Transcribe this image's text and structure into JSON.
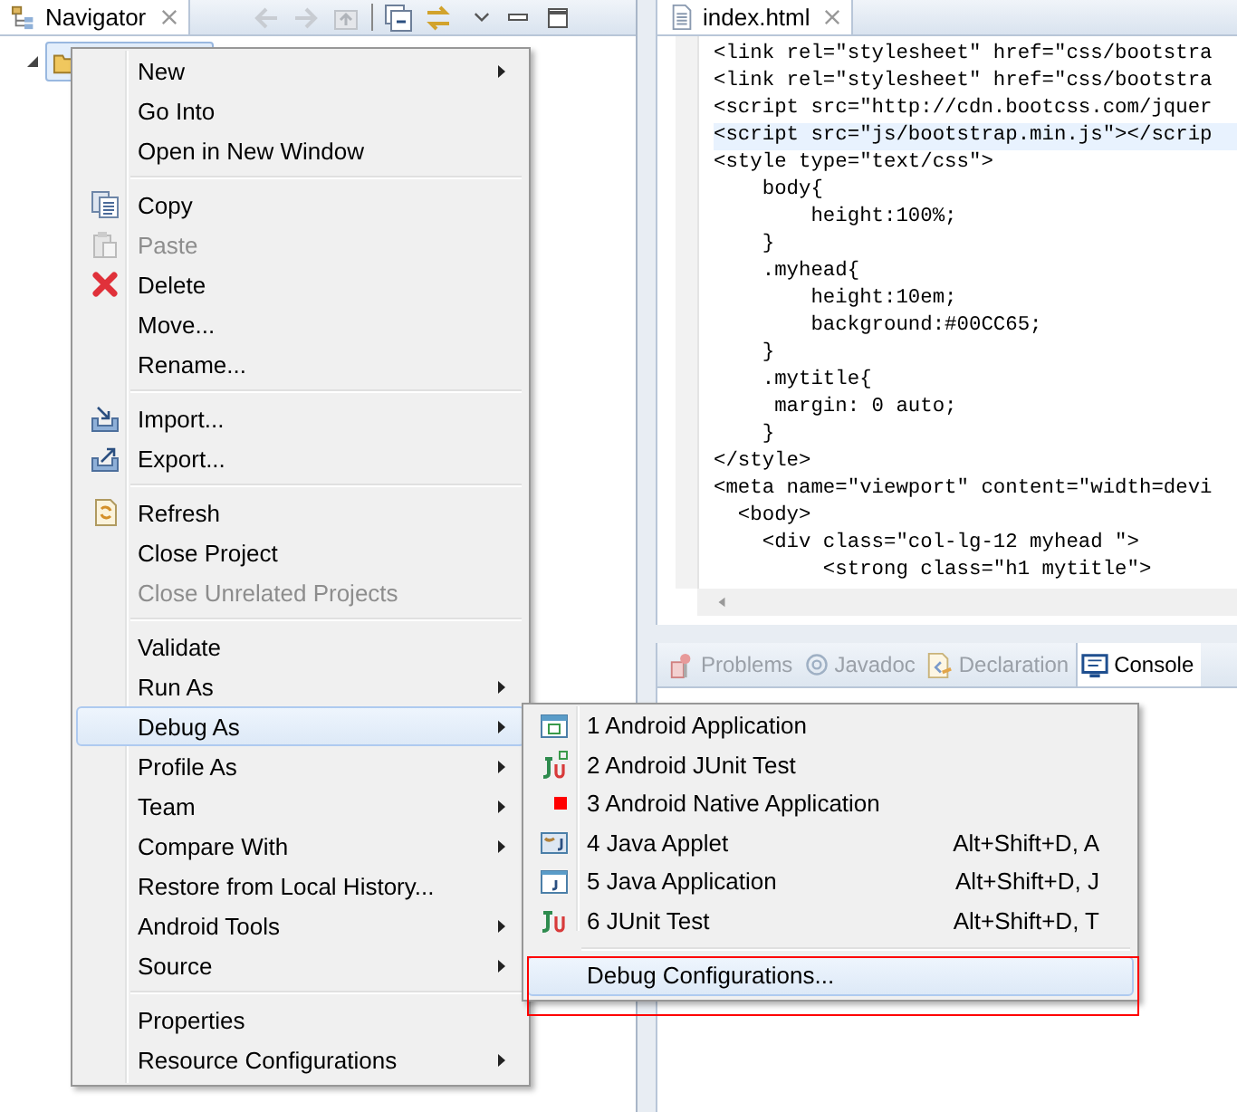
{
  "navigator": {
    "tab": {
      "label": "Navigator",
      "selected": true
    },
    "tree_root": {
      "expanded": true,
      "selected": true
    }
  },
  "editor": {
    "tab": {
      "label": "index.html",
      "selected": true
    },
    "lines": [
      {
        "text": "<link rel=\"stylesheet\" href=\"css/bootstra",
        "current": false
      },
      {
        "text": "<link rel=\"stylesheet\" href=\"css/bootstra",
        "current": false
      },
      {
        "text": "<script src=\"http://cdn.bootcss.com/jquer",
        "current": false
      },
      {
        "text": "<script src=\"js/bootstrap.min.js\"></scrip",
        "current": true
      },
      {
        "text": "<style type=\"text/css\">",
        "current": false
      },
      {
        "text": "    body{",
        "current": false
      },
      {
        "text": "        height:100%;",
        "current": false
      },
      {
        "text": "    }",
        "current": false
      },
      {
        "text": "    .myhead{",
        "current": false
      },
      {
        "text": "        height:10em;",
        "current": false
      },
      {
        "text": "        background:#00CC65;",
        "current": false
      },
      {
        "text": "    }",
        "current": false
      },
      {
        "text": "    .mytitle{",
        "current": false
      },
      {
        "text": "     margin: 0 auto;",
        "current": false
      },
      {
        "text": "    }",
        "current": false
      },
      {
        "text": "</style>",
        "current": false
      },
      {
        "text": "<meta name=\"viewport\" content=\"width=devi",
        "current": false
      },
      {
        "text": "  <body>",
        "current": false
      },
      {
        "text": "    <div class=\"col-lg-12 myhead \">",
        "current": false
      },
      {
        "text": "         <strong class=\"h1 mytitle\">",
        "current": false
      }
    ]
  },
  "bottom_tabs": [
    {
      "label": "Problems",
      "kind": "problems",
      "selected": false
    },
    {
      "label": "Javadoc",
      "kind": "javadoc",
      "selected": false
    },
    {
      "label": "Declaration",
      "kind": "declaration",
      "selected": false
    },
    {
      "label": "Console",
      "kind": "console",
      "selected": true
    }
  ],
  "context_menu": {
    "groups": [
      [
        {
          "label": "New",
          "kind": "plain",
          "submenu": true,
          "disabled": false,
          "selected": false
        },
        {
          "label": "Go Into",
          "kind": "plain",
          "submenu": false,
          "disabled": false,
          "selected": false
        },
        {
          "label": "Open in New Window",
          "kind": "plain",
          "submenu": false,
          "disabled": false,
          "selected": false
        }
      ],
      [
        {
          "label": "Copy",
          "kind": "copy",
          "submenu": false,
          "disabled": false,
          "selected": false
        },
        {
          "label": "Paste",
          "kind": "paste",
          "submenu": false,
          "disabled": true,
          "selected": false
        },
        {
          "label": "Delete",
          "kind": "delete",
          "submenu": false,
          "disabled": false,
          "selected": false
        },
        {
          "label": "Move...",
          "kind": "plain",
          "submenu": false,
          "disabled": false,
          "selected": false
        },
        {
          "label": "Rename...",
          "kind": "plain",
          "submenu": false,
          "disabled": false,
          "selected": false
        }
      ],
      [
        {
          "label": "Import...",
          "kind": "import",
          "submenu": false,
          "disabled": false,
          "selected": false
        },
        {
          "label": "Export...",
          "kind": "export",
          "submenu": false,
          "disabled": false,
          "selected": false
        }
      ],
      [
        {
          "label": "Refresh",
          "kind": "refresh",
          "submenu": false,
          "disabled": false,
          "selected": false
        },
        {
          "label": "Close Project",
          "kind": "plain",
          "submenu": false,
          "disabled": false,
          "selected": false
        },
        {
          "label": "Close Unrelated Projects",
          "kind": "plain",
          "submenu": false,
          "disabled": true,
          "selected": false
        }
      ],
      [
        {
          "label": "Validate",
          "kind": "plain",
          "submenu": false,
          "disabled": false,
          "selected": false
        },
        {
          "label": "Run As",
          "kind": "plain",
          "submenu": true,
          "disabled": false,
          "selected": false
        },
        {
          "label": "Debug As",
          "kind": "plain",
          "submenu": true,
          "disabled": false,
          "selected": true
        },
        {
          "label": "Profile As",
          "kind": "plain",
          "submenu": true,
          "disabled": false,
          "selected": false
        },
        {
          "label": "Team",
          "kind": "plain",
          "submenu": true,
          "disabled": false,
          "selected": false
        },
        {
          "label": "Compare With",
          "kind": "plain",
          "submenu": true,
          "disabled": false,
          "selected": false
        },
        {
          "label": "Restore from Local History...",
          "kind": "plain",
          "submenu": false,
          "disabled": false,
          "selected": false
        },
        {
          "label": "Android Tools",
          "kind": "plain",
          "submenu": true,
          "disabled": false,
          "selected": false
        },
        {
          "label": "Source",
          "kind": "plain",
          "submenu": true,
          "disabled": false,
          "selected": false
        }
      ],
      [
        {
          "label": "Properties",
          "kind": "plain",
          "submenu": false,
          "disabled": false,
          "selected": false
        },
        {
          "label": "Resource Configurations",
          "kind": "plain",
          "submenu": true,
          "disabled": false,
          "selected": false
        }
      ]
    ]
  },
  "debug_submenu": {
    "groups": [
      [
        {
          "label": "1 Android Application",
          "kind": "android-app",
          "selected": false
        },
        {
          "label": "2 Android JUnit Test",
          "kind": "android-junit",
          "selected": false
        },
        {
          "label": "3 Android Native Application",
          "kind": "native",
          "selected": false
        },
        {
          "label": "4 Java Applet",
          "shortcut": "Alt+Shift+D, A",
          "kind": "applet",
          "selected": false
        },
        {
          "label": "5 Java Application",
          "shortcut": "Alt+Shift+D, J",
          "kind": "java-app",
          "selected": false
        },
        {
          "label": "6 JUnit Test",
          "shortcut": "Alt+Shift+D, T",
          "kind": "junit",
          "selected": false
        }
      ],
      [
        {
          "label": "Debug Configurations...",
          "kind": "plain",
          "selected": true,
          "outlined": true
        }
      ]
    ]
  }
}
